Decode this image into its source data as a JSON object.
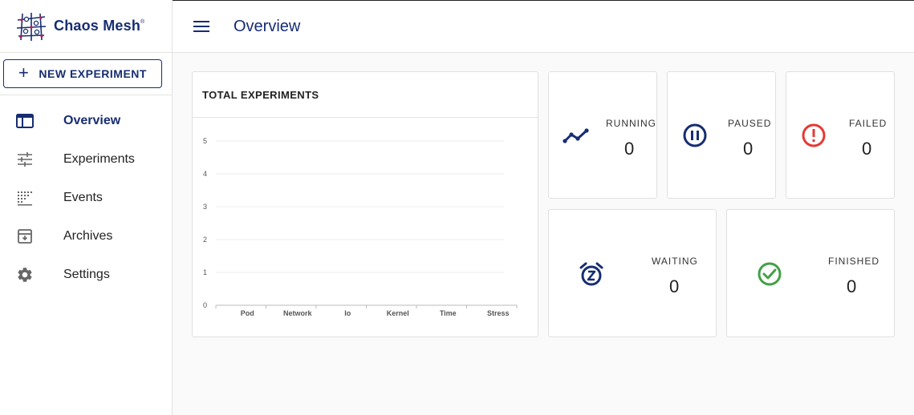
{
  "brand": {
    "name": "Chaos Mesh",
    "trademark": "®"
  },
  "sidebar": {
    "new_button": "NEW EXPERIMENT",
    "items": [
      {
        "label": "Overview",
        "icon": "dashboard-icon",
        "active": true
      },
      {
        "label": "Experiments",
        "icon": "tune-icon",
        "active": false
      },
      {
        "label": "Events",
        "icon": "grid-icon",
        "active": false
      },
      {
        "label": "Archives",
        "icon": "archive-icon",
        "active": false
      },
      {
        "label": "Settings",
        "icon": "gear-icon",
        "active": false
      }
    ]
  },
  "header": {
    "title": "Overview"
  },
  "chart_card": {
    "title": "TOTAL EXPERIMENTS"
  },
  "chart_data": {
    "type": "bar",
    "title": "TOTAL EXPERIMENTS",
    "categories": [
      "Pod",
      "Network",
      "Io",
      "Kernel",
      "Time",
      "Stress"
    ],
    "values": [
      0,
      0,
      0,
      0,
      0,
      0
    ],
    "ylim": [
      0,
      5
    ],
    "yticks": [
      "0",
      "1",
      "2",
      "3",
      "4",
      "5"
    ],
    "xlabel": "",
    "ylabel": "",
    "grid": true
  },
  "stats": {
    "running": {
      "label": "RUNNING",
      "value": "0",
      "icon": "trend-icon",
      "color": "#172d72"
    },
    "paused": {
      "label": "PAUSED",
      "value": "0",
      "icon": "pause-circle-icon",
      "color": "#172d72"
    },
    "failed": {
      "label": "FAILED",
      "value": "0",
      "icon": "error-icon",
      "color": "#e53935"
    },
    "waiting": {
      "label": "WAITING",
      "value": "0",
      "icon": "snooze-icon",
      "color": "#172d72"
    },
    "finished": {
      "label": "FINISHED",
      "value": "0",
      "icon": "check-circle-icon",
      "color": "#43a047"
    }
  }
}
